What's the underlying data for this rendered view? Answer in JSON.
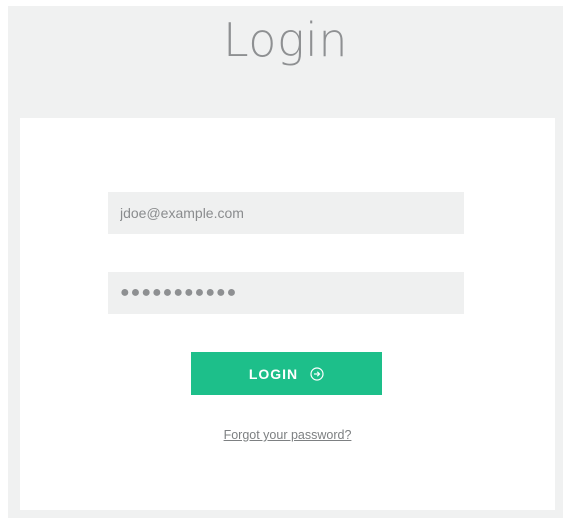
{
  "header": {
    "title": "Login"
  },
  "form": {
    "email_value": "jdoe@example.com",
    "password_value": "●●●●●●●●●●●",
    "login_label": "LOGIN",
    "login_icon": "arrow-circle-right-icon",
    "forgot_label": "Forgot your password?"
  },
  "colors": {
    "accent": "#1dbf8a",
    "background": "#f0f1f1",
    "field_background": "#eff0f0",
    "text_muted": "#8e9092"
  }
}
